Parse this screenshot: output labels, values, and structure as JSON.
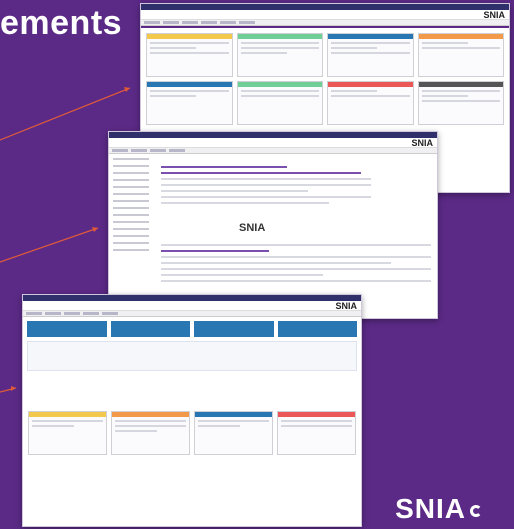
{
  "heading": "ements",
  "shots": [
    {
      "name": "dashboard-screenshot-1",
      "brand": "SNIA"
    },
    {
      "name": "dashboard-screenshot-2",
      "brand": "SNIA",
      "center_brand": "SNIA"
    },
    {
      "name": "dashboard-screenshot-3",
      "brand": "SNIA"
    }
  ],
  "logo": "SNIA",
  "colors": {
    "background": "#5b2a86",
    "arrow": "#e05a3a",
    "accent_blue": "#2877b2"
  }
}
